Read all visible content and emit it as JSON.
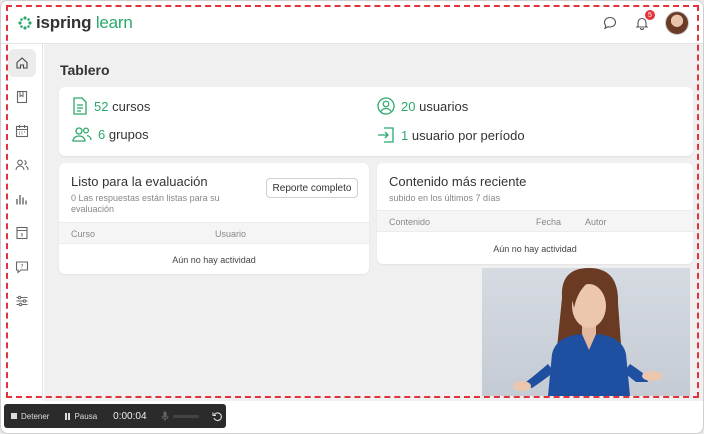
{
  "app": {
    "logo_name": "ispring",
    "logo_suffix": "learn",
    "brand_color": "#2aa96b",
    "notifications_count": "5"
  },
  "topbar": {
    "icons": [
      "chat-icon",
      "bell-icon",
      "avatar"
    ]
  },
  "sidebar": {
    "items": [
      {
        "icon": "home-icon",
        "active": true
      },
      {
        "icon": "book-icon",
        "active": false
      },
      {
        "icon": "calendar-icon",
        "active": false
      },
      {
        "icon": "users-icon",
        "active": false
      },
      {
        "icon": "bar-chart-icon",
        "active": false
      },
      {
        "icon": "info-page-icon",
        "active": false
      },
      {
        "icon": "question-chat-icon",
        "active": false
      },
      {
        "icon": "sliders-icon",
        "active": false
      }
    ]
  },
  "page": {
    "title": "Tablero"
  },
  "stats": {
    "courses_num": "52",
    "courses_label": "cursos",
    "users_num": "20",
    "users_label": "usuarios",
    "groups_num": "6",
    "groups_label": "grupos",
    "period_num": "1",
    "period_label": "usuario por período"
  },
  "evaluation": {
    "title": "Listo para la evaluación",
    "subtitle": "0 Las respuestas están listas para su evaluación",
    "button": "Reporte completo",
    "col_course": "Curso",
    "col_user": "Usuario",
    "empty": "Aún no hay actividad"
  },
  "recent": {
    "title": "Contenido más reciente",
    "subtitle": "subido en los últimos 7 días",
    "col_content": "Contenido",
    "col_date": "Fecha",
    "col_author": "Autor",
    "empty": "Aún no hay actividad"
  },
  "recorder": {
    "stop": "Detener",
    "pause": "Pausa",
    "time": "0:00:04",
    "record_color": "#e0333a"
  }
}
